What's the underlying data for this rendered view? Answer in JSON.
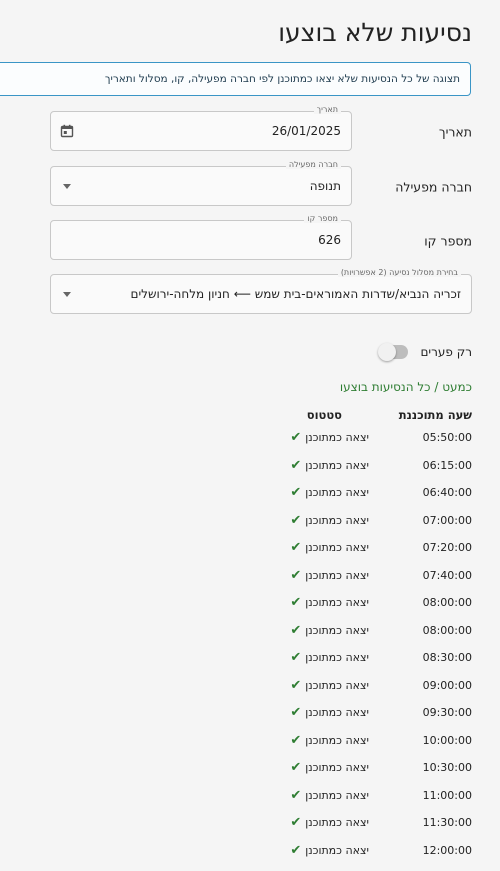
{
  "page": {
    "title": "נסיעות שלא בוצעו",
    "info": "תצוגה של כל הנסיעות שלא יצאו כמתוכנן לפי חברה מפעילה, קו, מסלול ותאריך"
  },
  "form": {
    "date": {
      "label": "תאריך",
      "legend": "תאריך",
      "value": "26/01/2025"
    },
    "operator": {
      "label": "חברה מפעילה",
      "legend": "חברה מפעילה",
      "value": "תנופה"
    },
    "line": {
      "label": "מספר קו",
      "legend": "מספר קו",
      "value": "626"
    },
    "route": {
      "legend": "בחירת מסלול נסיעה (2 אפשרויות)",
      "value": "זכריה הנביא/שדרות האמוראים-בית שמש ⟵ חניון מלחה-ירושלים"
    }
  },
  "toggle": {
    "label": "רק פערים",
    "on": false
  },
  "summary": "כמעט / כל הנסיעות בוצעו",
  "table": {
    "headers": {
      "time": "שעה מתוכננת",
      "status": "סטטוס"
    },
    "rows": [
      {
        "time": "05:50:00",
        "status": "יצאה כמתוכנן"
      },
      {
        "time": "06:15:00",
        "status": "יצאה כמתוכנן"
      },
      {
        "time": "06:40:00",
        "status": "יצאה כמתוכנן"
      },
      {
        "time": "07:00:00",
        "status": "יצאה כמתוכנן"
      },
      {
        "time": "07:20:00",
        "status": "יצאה כמתוכנן"
      },
      {
        "time": "07:40:00",
        "status": "יצאה כמתוכנן"
      },
      {
        "time": "08:00:00",
        "status": "יצאה כמתוכנן"
      },
      {
        "time": "08:00:00",
        "status": "יצאה כמתוכנן"
      },
      {
        "time": "08:30:00",
        "status": "יצאה כמתוכנן"
      },
      {
        "time": "09:00:00",
        "status": "יצאה כמתוכנן"
      },
      {
        "time": "09:30:00",
        "status": "יצאה כמתוכנן"
      },
      {
        "time": "10:00:00",
        "status": "יצאה כמתוכנן"
      },
      {
        "time": "10:30:00",
        "status": "יצאה כמתוכנן"
      },
      {
        "time": "11:00:00",
        "status": "יצאה כמתוכנן"
      },
      {
        "time": "11:30:00",
        "status": "יצאה כמתוכנן"
      },
      {
        "time": "12:00:00",
        "status": "יצאה כמתוכנן"
      }
    ]
  },
  "icons": {
    "date": "calendar-icon",
    "dropdown": "caret-down-icon",
    "status_ok": "check-icon"
  },
  "colors": {
    "accent": "#3a95c6",
    "success": "#2e7d32"
  }
}
